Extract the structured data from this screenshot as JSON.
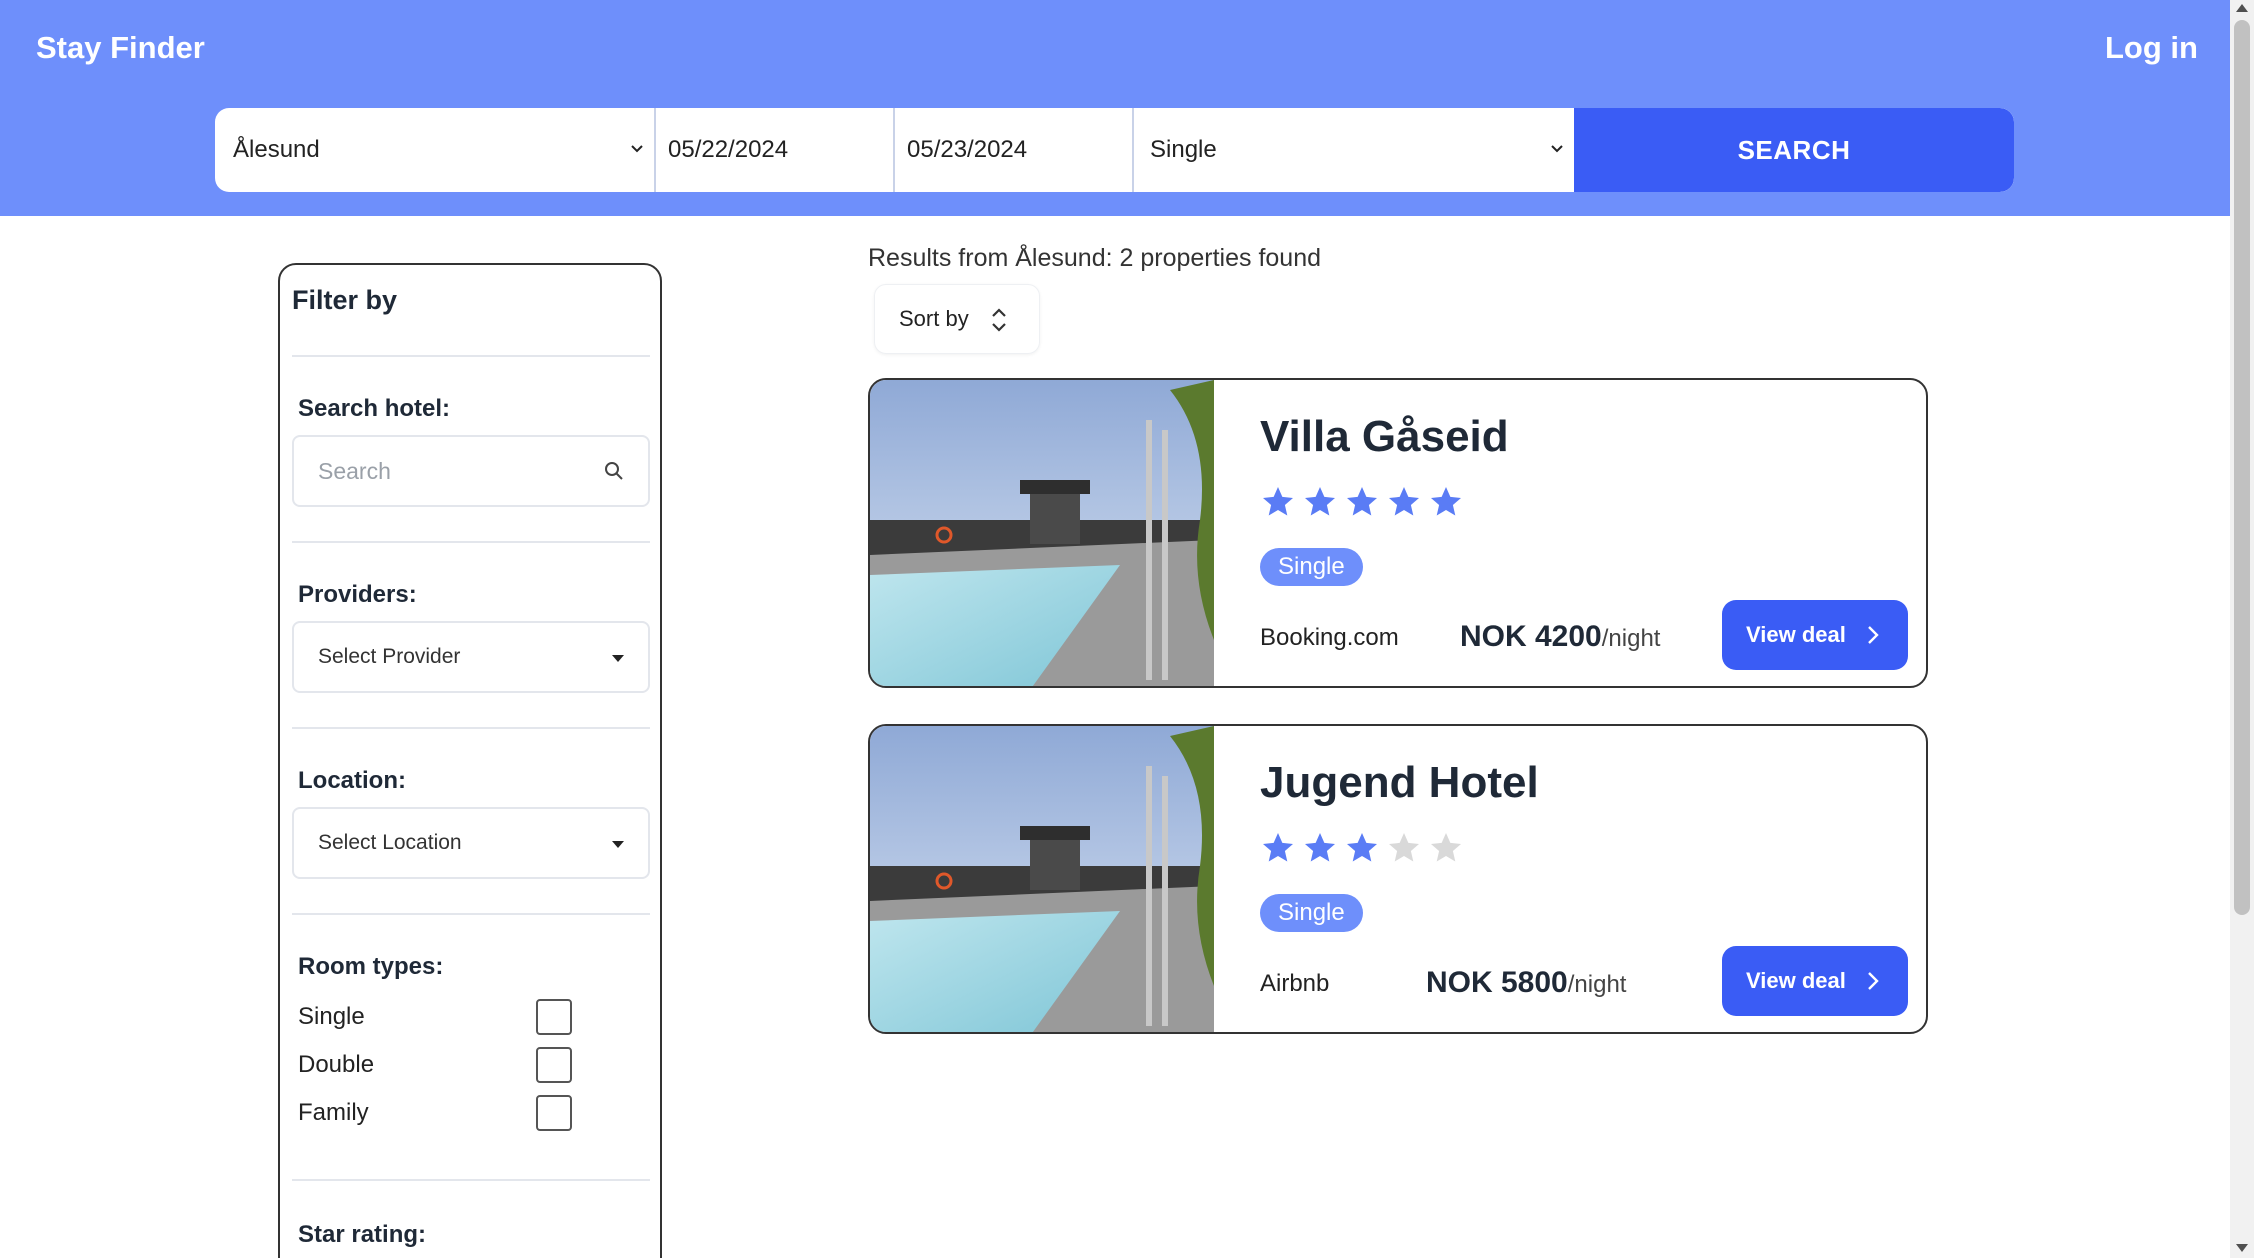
{
  "header": {
    "brand": "Stay Finder",
    "login": "Log in"
  },
  "search": {
    "location": "Ålesund",
    "checkin": "05/22/2024",
    "checkout": "05/23/2024",
    "room_type": "Single",
    "button": "SEARCH"
  },
  "filter": {
    "title": "Filter by",
    "search_label": "Search hotel:",
    "search_placeholder": "Search",
    "providers_label": "Providers:",
    "providers_value": "Select Provider",
    "location_label": "Location:",
    "location_value": "Select Location",
    "room_types_label": "Room types:",
    "room_types": [
      "Single",
      "Double",
      "Family"
    ],
    "star_rating_label": "Star rating:"
  },
  "results": {
    "summary": "Results from Ålesund: 2 properties found",
    "sort_label": "Sort by",
    "properties": [
      {
        "name": "Villa Gåseid",
        "stars": 5,
        "room_type": "Single",
        "provider": "Booking.com",
        "price": "NOK 4200",
        "per": "/night",
        "button": "View deal"
      },
      {
        "name": "Jugend Hotel",
        "stars": 3,
        "room_type": "Single",
        "provider": "Airbnb",
        "price": "NOK 5800",
        "per": "/night",
        "button": "View deal"
      }
    ]
  },
  "colors": {
    "header_bg": "#6e8ffb",
    "primary": "#3a5cf5",
    "star_filled": "#5a7cf5",
    "star_empty": "#d9d9d9"
  }
}
